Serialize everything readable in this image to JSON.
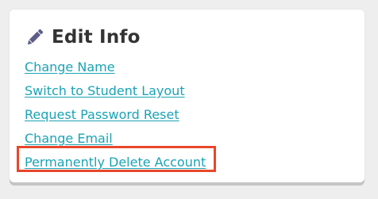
{
  "panel": {
    "icon": "pencil-icon",
    "title": "Edit Info"
  },
  "links": [
    {
      "label": "Change Name"
    },
    {
      "label": "Switch to Student Layout"
    },
    {
      "label": "Request Password Reset"
    },
    {
      "label": "Change Email"
    },
    {
      "label": "Permanently Delete Account"
    }
  ],
  "colors": {
    "link": "#1aa3b5",
    "title": "#333333",
    "icon": "#5b5e87",
    "highlight": "#e8472b"
  }
}
